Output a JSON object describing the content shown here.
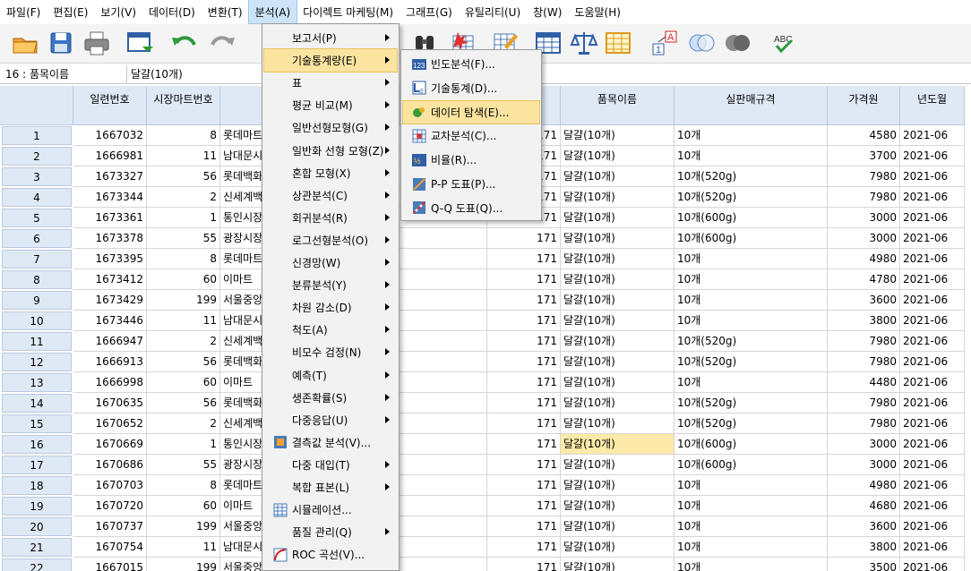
{
  "menubar": [
    "파일(F)",
    "편집(E)",
    "보기(V)",
    "데이터(D)",
    "변환(T)",
    "분석(A)",
    "다이렉트 마케팅(M)",
    "그래프(G)",
    "유틸리티(U)",
    "창(W)",
    "도움말(H)"
  ],
  "cellbar": {
    "ref": "16 : 품목이름",
    "value": "달걀(10개)"
  },
  "columns": [
    "일련번호",
    "시장마트번호",
    "",
    "",
    "품목이름",
    "실판매규격",
    "가격원",
    "년도월"
  ],
  "rows": [
    {
      "n": "1",
      "id": "1667032",
      "mk": "8",
      "name": "롯데마트",
      "code": "171",
      "item": "달걀(10개)",
      "spec": "10개",
      "price": "4580",
      "ym": "2021-06"
    },
    {
      "n": "2",
      "id": "1666981",
      "mk": "11",
      "name": "남대문시",
      "code": "171",
      "item": "달걀(10개)",
      "spec": "10개",
      "price": "3700",
      "ym": "2021-06"
    },
    {
      "n": "3",
      "id": "1673327",
      "mk": "56",
      "name": "롯데백화",
      "code": "171",
      "item": "달걀(10개)",
      "spec": "10개(520g)",
      "price": "7980",
      "ym": "2021-06"
    },
    {
      "n": "4",
      "id": "1673344",
      "mk": "2",
      "name": "신세계백",
      "code": "171",
      "item": "달걀(10개)",
      "spec": "10개(520g)",
      "price": "7980",
      "ym": "2021-06"
    },
    {
      "n": "5",
      "id": "1673361",
      "mk": "1",
      "name": "통인시장",
      "code": "171",
      "item": "달걀(10개)",
      "spec": "10개(600g)",
      "price": "3000",
      "ym": "2021-06"
    },
    {
      "n": "6",
      "id": "1673378",
      "mk": "55",
      "name": "광장시장",
      "code": "171",
      "item": "달걀(10개)",
      "spec": "10개(600g)",
      "price": "3000",
      "ym": "2021-06"
    },
    {
      "n": "7",
      "id": "1673395",
      "mk": "8",
      "name": "롯데마트",
      "code": "171",
      "item": "달걀(10개)",
      "spec": "10개",
      "price": "4980",
      "ym": "2021-06"
    },
    {
      "n": "8",
      "id": "1673412",
      "mk": "60",
      "name": "이마트",
      "code": "171",
      "item": "달걀(10개)",
      "spec": "10개",
      "price": "4780",
      "ym": "2021-06"
    },
    {
      "n": "9",
      "id": "1673429",
      "mk": "199",
      "name": "서울중앙",
      "code": "171",
      "item": "달걀(10개)",
      "spec": "10개",
      "price": "3600",
      "ym": "2021-06"
    },
    {
      "n": "10",
      "id": "1673446",
      "mk": "11",
      "name": "남대문시",
      "code": "171",
      "item": "달걀(10개)",
      "spec": "10개",
      "price": "3800",
      "ym": "2021-06"
    },
    {
      "n": "11",
      "id": "1666947",
      "mk": "2",
      "name": "신세계백",
      "code": "171",
      "item": "달걀(10개)",
      "spec": "10개(520g)",
      "price": "7980",
      "ym": "2021-06"
    },
    {
      "n": "12",
      "id": "1666913",
      "mk": "56",
      "name": "롯데백화",
      "code": "171",
      "item": "달걀(10개)",
      "spec": "10개(520g)",
      "price": "7980",
      "ym": "2021-06"
    },
    {
      "n": "13",
      "id": "1666998",
      "mk": "60",
      "name": "이마트",
      "code": "171",
      "item": "달걀(10개)",
      "spec": "10개",
      "price": "4480",
      "ym": "2021-06"
    },
    {
      "n": "14",
      "id": "1670635",
      "mk": "56",
      "name": "롯데백화",
      "code": "171",
      "item": "달걀(10개)",
      "spec": "10개(520g)",
      "price": "7980",
      "ym": "2021-06"
    },
    {
      "n": "15",
      "id": "1670652",
      "mk": "2",
      "name": "신세계백",
      "code": "171",
      "item": "달걀(10개)",
      "spec": "10개(520g)",
      "price": "7980",
      "ym": "2021-06"
    },
    {
      "n": "16",
      "id": "1670669",
      "mk": "1",
      "name": "통인시장",
      "code": "171",
      "item": "달걀(10개)",
      "spec": "10개(600g)",
      "price": "3000",
      "ym": "2021-06"
    },
    {
      "n": "17",
      "id": "1670686",
      "mk": "55",
      "name": "광장시장",
      "code": "171",
      "item": "달걀(10개)",
      "spec": "10개(600g)",
      "price": "3000",
      "ym": "2021-06"
    },
    {
      "n": "18",
      "id": "1670703",
      "mk": "8",
      "name": "롯데마트",
      "code": "171",
      "item": "달걀(10개)",
      "spec": "10개",
      "price": "4980",
      "ym": "2021-06"
    },
    {
      "n": "19",
      "id": "1670720",
      "mk": "60",
      "name": "이마트",
      "code": "171",
      "item": "달걀(10개)",
      "spec": "10개",
      "price": "4680",
      "ym": "2021-06"
    },
    {
      "n": "20",
      "id": "1670737",
      "mk": "199",
      "name": "서울중앙",
      "code": "171",
      "item": "달걀(10개)",
      "spec": "10개",
      "price": "3600",
      "ym": "2021-06"
    },
    {
      "n": "21",
      "id": "1670754",
      "mk": "11",
      "name": "남대문시",
      "code": "171",
      "item": "달걀(10개)",
      "spec": "10개",
      "price": "3800",
      "ym": "2021-06"
    },
    {
      "n": "22",
      "id": "1667015",
      "mk": "199",
      "name": "서울중앙",
      "code": "171",
      "item": "달걀(10개)",
      "spec": "10개",
      "price": "3500",
      "ym": "2021-06"
    }
  ],
  "analyze_menu": [
    {
      "label": "보고서(P)",
      "sub": true
    },
    {
      "label": "기술통계량(E)",
      "sub": true
    },
    {
      "label": "표",
      "sub": true
    },
    {
      "label": "평균 비교(M)",
      "sub": true
    },
    {
      "label": "일반선형모형(G)",
      "sub": true
    },
    {
      "label": "일반화 선형 모형(Z)",
      "sub": true
    },
    {
      "label": "혼합 모형(X)",
      "sub": true
    },
    {
      "label": "상관분석(C)",
      "sub": true
    },
    {
      "label": "회귀분석(R)",
      "sub": true
    },
    {
      "label": "로그선형분석(O)",
      "sub": true
    },
    {
      "label": "신경망(W)",
      "sub": true
    },
    {
      "label": "분류분석(Y)",
      "sub": true
    },
    {
      "label": "차원 감소(D)",
      "sub": true
    },
    {
      "label": "척도(A)",
      "sub": true
    },
    {
      "label": "비모수 검정(N)",
      "sub": true
    },
    {
      "label": "예측(T)",
      "sub": true
    },
    {
      "label": "생존확률(S)",
      "sub": true
    },
    {
      "label": "다중응답(U)",
      "sub": true
    },
    {
      "label": "결측값 분석(V)...",
      "sub": false,
      "icon": "missing-value-icon"
    },
    {
      "label": "다중 대입(T)",
      "sub": true
    },
    {
      "label": "복합 표본(L)",
      "sub": true
    },
    {
      "label": "시뮬레이션...",
      "sub": false,
      "icon": "simulation-icon"
    },
    {
      "label": "품질 관리(Q)",
      "sub": true
    },
    {
      "label": "ROC 곡선(V)...",
      "sub": false,
      "icon": "roc-icon"
    }
  ],
  "desc_menu": [
    {
      "label": "빈도분석(F)...",
      "icon": "frequencies-icon"
    },
    {
      "label": "기술통계(D)...",
      "icon": "descriptives-icon"
    },
    {
      "label": "데이터 탐색(E)...",
      "icon": "explore-icon"
    },
    {
      "label": "교차분석(C)...",
      "icon": "crosstabs-icon"
    },
    {
      "label": "비율(R)...",
      "icon": "ratio-icon"
    },
    {
      "label": "P-P 도표(P)...",
      "icon": "pp-plot-icon"
    },
    {
      "label": "Q-Q 도표(Q)...",
      "icon": "qq-plot-icon"
    }
  ],
  "colors": {
    "menu_highlight": "#fbe4a0",
    "header_bg": "#dfe9f5",
    "selected_cell": "#fde9a8"
  }
}
